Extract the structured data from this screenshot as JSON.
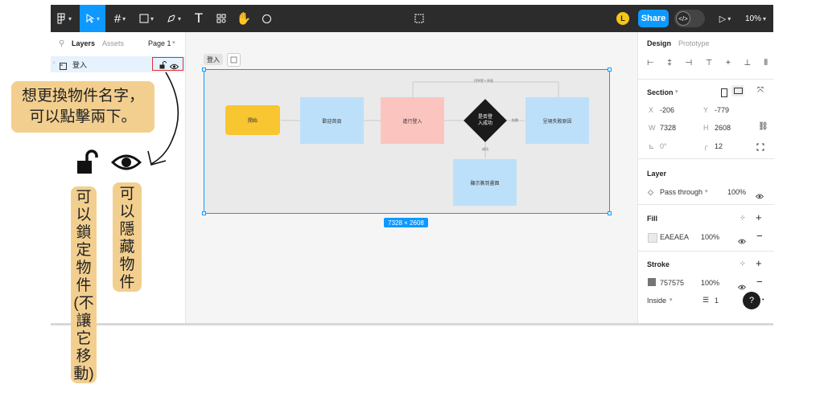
{
  "toolbar": {
    "file_title_icon": "component-icon",
    "share_label": "Share",
    "avatar_initial": "L",
    "zoom": "10%"
  },
  "left_panel": {
    "tabs": [
      "Layers",
      "Assets"
    ],
    "page_selector": "Page 1",
    "layer_name": "登入"
  },
  "canvas": {
    "frame_label": "登入",
    "frame_size_badge": "7328 × 2608",
    "nodes": {
      "start": "開始",
      "welcome": "歡迎首頁",
      "login": "進行登入",
      "decision_line1": "是否登",
      "decision_line2": "入成功",
      "fail": "呈現失敗原因",
      "success_screen": "顯示簽到畫面",
      "loop_label": "回到登入頁面",
      "fail_label": "失敗",
      "success_label": "成功"
    },
    "colors": {
      "start": "#f8c630",
      "welcome": "#bde0fa",
      "login": "#fcc4bf",
      "decision": "#1a1a1a",
      "frame_fill": "#EAEAEA",
      "frame_stroke": "#757575"
    }
  },
  "right_panel": {
    "tabs": [
      "Design",
      "Prototype"
    ],
    "section_label": "Section",
    "x_label": "X",
    "x_value": "-206",
    "y_label": "Y",
    "y_value": "-779",
    "w_label": "W",
    "w_value": "7328",
    "h_label": "H",
    "h_value": "2608",
    "rotation": "0°",
    "radius": "12",
    "layer_title": "Layer",
    "blend_mode": "Pass through",
    "layer_opacity": "100%",
    "fill_title": "Fill",
    "fill_hex": "EAEAEA",
    "fill_opacity": "100%",
    "stroke_title": "Stroke",
    "stroke_hex": "757575",
    "stroke_opacity": "100%",
    "stroke_position": "Inside",
    "stroke_weight": "1",
    "help": "?"
  },
  "annotations": {
    "rename_line1": "想更換物件名字，",
    "rename_line2": "可以點擊兩下。",
    "lock_note": [
      "可",
      "以",
      "鎖",
      "定",
      "物",
      "件",
      "(不",
      "讓",
      "它",
      "移",
      "動)"
    ],
    "hide_note": [
      "可",
      "以",
      "隱",
      "藏",
      "物",
      "件"
    ]
  }
}
